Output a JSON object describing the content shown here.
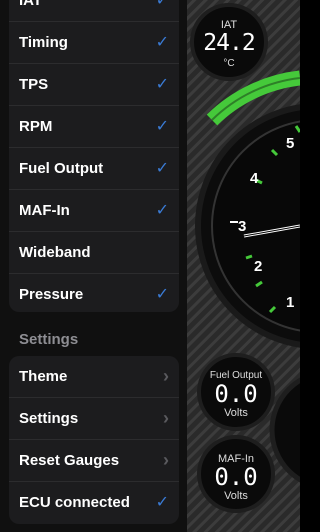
{
  "sensors": [
    {
      "label": "IAT",
      "checked": true
    },
    {
      "label": "Timing",
      "checked": true
    },
    {
      "label": "TPS",
      "checked": true
    },
    {
      "label": "RPM",
      "checked": true
    },
    {
      "label": "Fuel Output",
      "checked": true
    },
    {
      "label": "MAF-In",
      "checked": true
    },
    {
      "label": "Wideband",
      "checked": false
    },
    {
      "label": "Pressure",
      "checked": true
    }
  ],
  "settings_header": "Settings",
  "settings_items": [
    {
      "label": "Theme",
      "type": "chevron"
    },
    {
      "label": "Settings",
      "type": "chevron"
    },
    {
      "label": "Reset Gauges",
      "type": "chevron"
    },
    {
      "label": "ECU connected",
      "type": "check"
    }
  ],
  "gauges": {
    "iat": {
      "name": "IAT",
      "value": "24.2",
      "unit": "°C"
    },
    "fuel": {
      "name": "Fuel Output",
      "value": "0.0",
      "unit": "Volts"
    },
    "maf": {
      "name": "MAF-In",
      "value": "0.0",
      "unit": "Volts"
    },
    "dial_numbers": [
      "1",
      "2",
      "3",
      "4",
      "5"
    ]
  },
  "icons": {
    "check": "✓",
    "chevron": "›"
  },
  "colors": {
    "accent_green": "#45c93a",
    "check_blue": "#3a7bd5"
  }
}
